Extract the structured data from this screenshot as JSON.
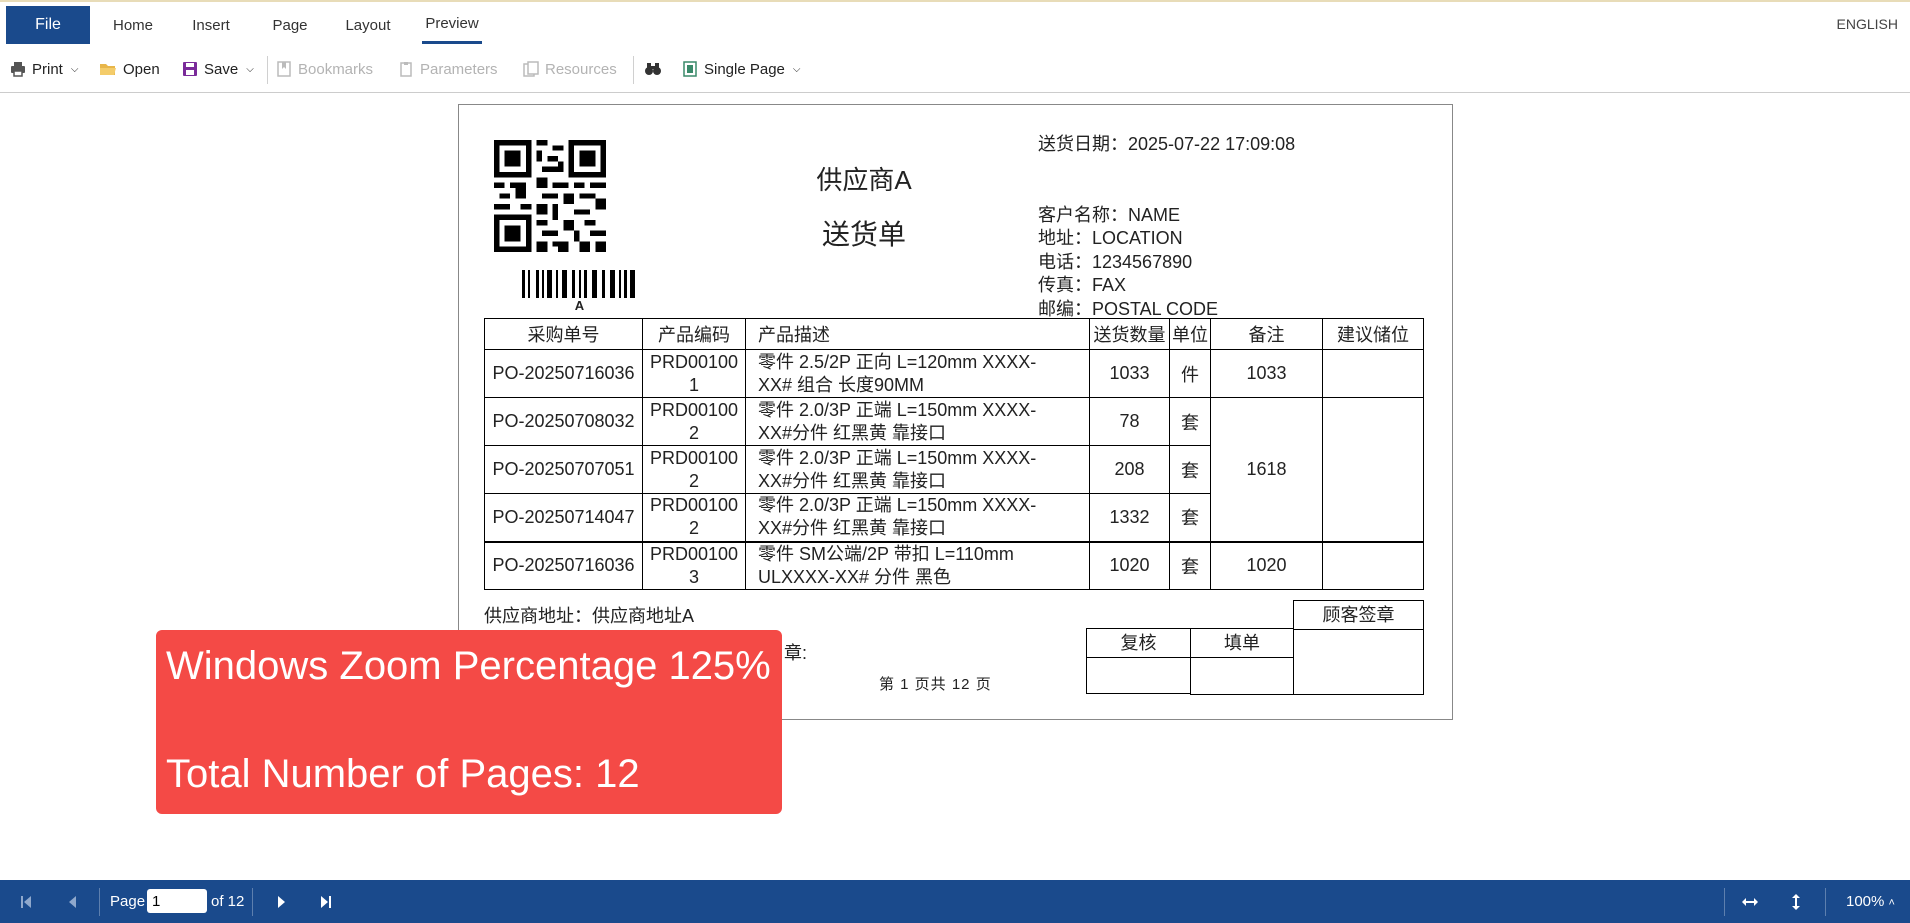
{
  "menu": {
    "file": "File",
    "tabs": [
      "Home",
      "Insert",
      "Page",
      "Layout",
      "Preview"
    ],
    "active_tab": "Preview",
    "language": "ENGLISH"
  },
  "toolbar": {
    "print": "Print",
    "open": "Open",
    "save": "Save",
    "bookmarks": "Bookmarks",
    "parameters": "Parameters",
    "resources": "Resources",
    "view_mode": "Single Page"
  },
  "report": {
    "barcode_text": "A",
    "supplier_name": "供应商A",
    "doc_title": "送货单",
    "delivery_date": "送货日期：2025-07-22 17:09:08",
    "customer_name": "客户名称：NAME",
    "address": "地址：LOCATION",
    "phone": "电话：1234567890",
    "fax": "传真：FAX",
    "postal": "邮编：POSTAL CODE",
    "headers": [
      "采购单号",
      "产品编码",
      "产品描述",
      "送货数量",
      "单位",
      "备注",
      "建议储位"
    ],
    "rows": [
      {
        "po": "PO-20250716036",
        "code1": "PRD00100",
        "code2": "1",
        "desc1": "零件 2.5/2P 正向 L=120mm XXXX-",
        "desc2": "XX#  组合 长度90MM",
        "qty": "1033",
        "unit": "件",
        "remark": "1033"
      },
      {
        "po": "PO-20250708032",
        "code1": "PRD00100",
        "code2": "2",
        "desc1": "零件 2.0/3P 正端 L=150mm XXXX-",
        "desc2": "XX#分件 红黑黄 靠接口",
        "qty": "78",
        "unit": "套",
        "remark": "1618"
      },
      {
        "po": "PO-20250707051",
        "code1": "PRD00100",
        "code2": "2",
        "desc1": "零件 2.0/3P 正端 L=150mm XXXX-",
        "desc2": "XX#分件 红黑黄 靠接口",
        "qty": "208",
        "unit": "套",
        "remark": ""
      },
      {
        "po": "PO-20250714047",
        "code1": "PRD00100",
        "code2": "2",
        "desc1": "零件 2.0/3P 正端 L=150mm XXXX-",
        "desc2": "XX#分件 红黑黄 靠接口",
        "qty": "1332",
        "unit": "套",
        "remark": ""
      },
      {
        "po": "PO-20250716036",
        "code1": "PRD00100",
        "code2": "3",
        "desc1": "零件 SM公端/2P 带扣 L=110mm",
        "desc2": "ULXXXX-XX# 分件 黑色",
        "qty": "1020",
        "unit": "套",
        "remark": "1020"
      }
    ],
    "supplier_address": "供应商地址：供应商地址A",
    "seal_label": "章:",
    "page_footer": "第  1   页共   12  页",
    "review": "复核",
    "fill": "填单",
    "customer_seal": "顾客签章"
  },
  "overlay": {
    "zoom_text": "Windows Zoom Percentage 125%",
    "pages_text": "Total Number of Pages: 12"
  },
  "bottom": {
    "page_label": "Page",
    "page_value": "1",
    "of_label": "of 12",
    "zoom": "100%"
  },
  "colors": {
    "accent": "#1a4a8c",
    "overlay": "#f44a46"
  }
}
